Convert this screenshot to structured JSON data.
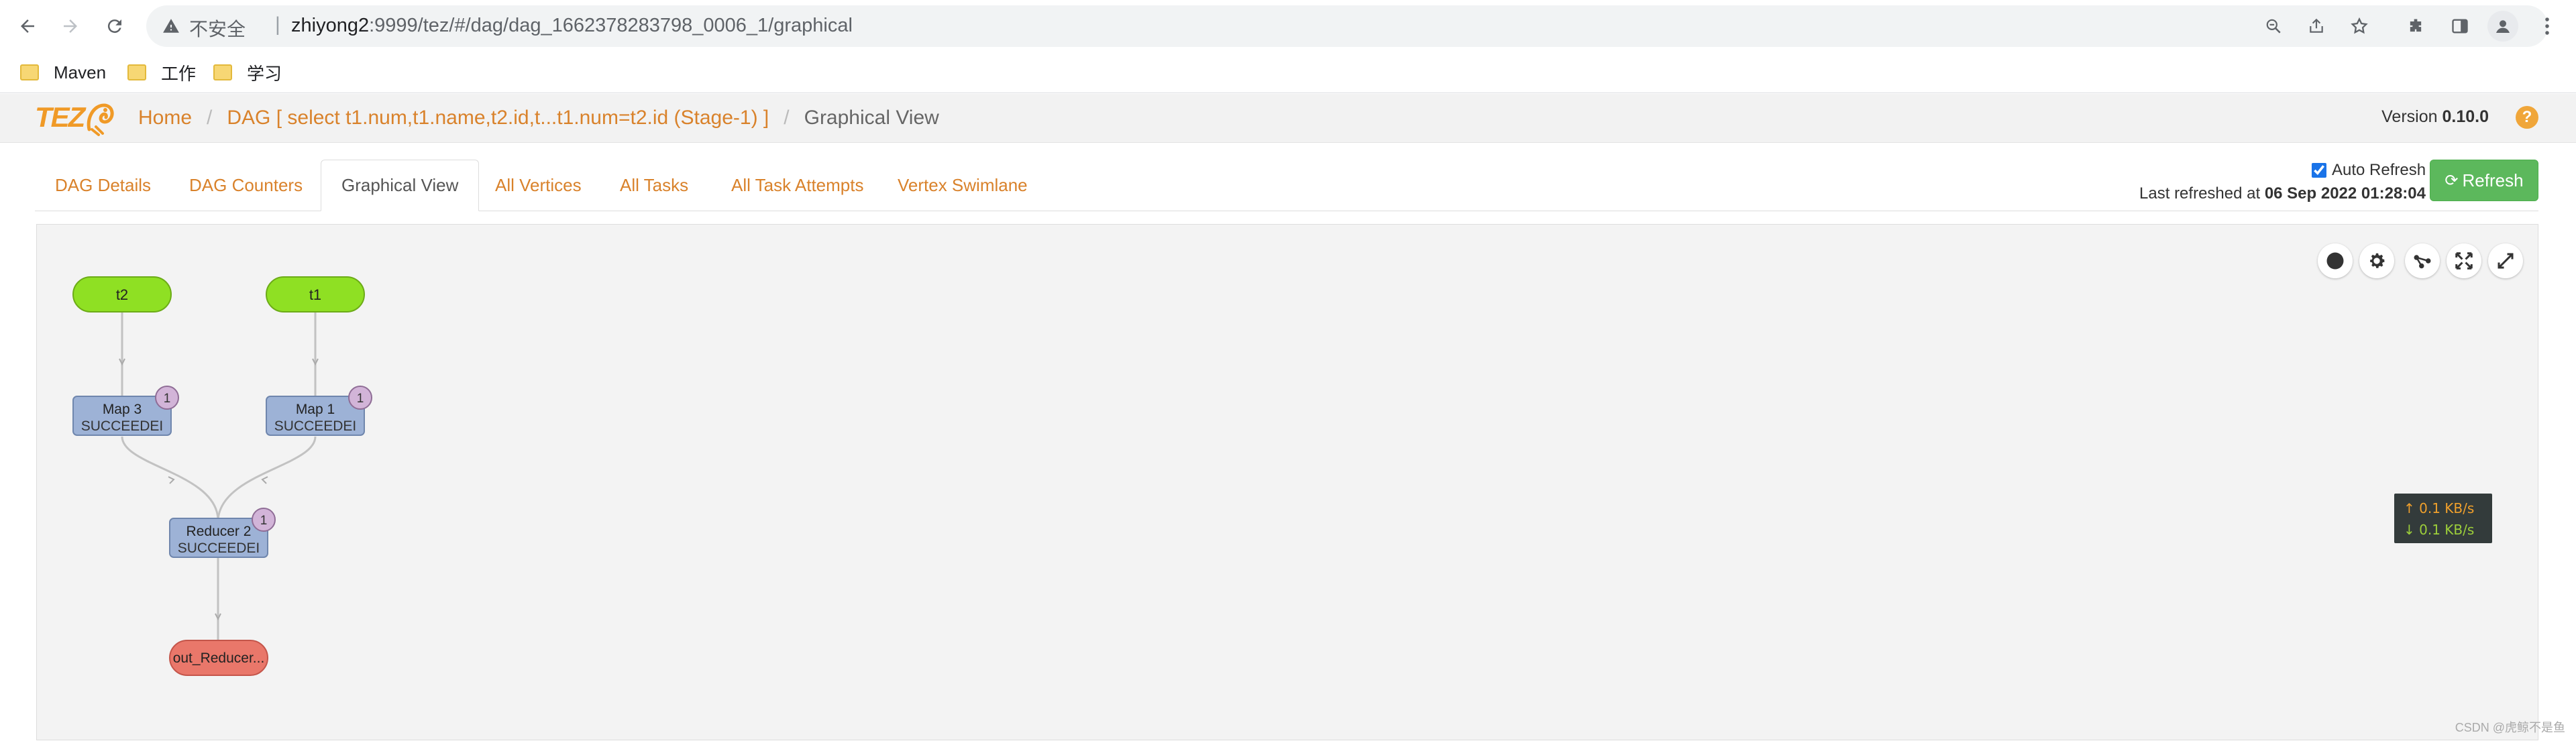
{
  "browser": {
    "security_label": "不安全",
    "url_host": "zhiyong2",
    "url_rest": ":9999/tez/#/dag/dag_1662378283798_0006_1/graphical",
    "bookmarks": [
      "Maven",
      "工作",
      "学习"
    ]
  },
  "header": {
    "logo_text": "TEZ",
    "breadcrumbs": {
      "home": "Home",
      "dag": "DAG [ select t1.num,t1.name,t2.id,t...t1.num=t2.id (Stage-1) ]",
      "current": "Graphical View"
    },
    "version_label": "Version",
    "version_value": "0.10.0",
    "help": "?"
  },
  "tabs": [
    {
      "label": "DAG Details"
    },
    {
      "label": "DAG Counters"
    },
    {
      "label": "Graphical View",
      "active": true
    },
    {
      "label": "All Vertices"
    },
    {
      "label": "All Tasks"
    },
    {
      "label": "All Task Attempts"
    },
    {
      "label": "Vertex Swimlane"
    }
  ],
  "refresh": {
    "auto_refresh_label": "Auto Refresh",
    "auto_refresh_checked": true,
    "last_refreshed_label": "Last refreshed at",
    "last_refreshed_value": "06 Sep 2022 01:28:04",
    "button_label": "Refresh"
  },
  "graph": {
    "sources": [
      {
        "name": "t2"
      },
      {
        "name": "t1"
      }
    ],
    "vertices": [
      {
        "name": "Map 3",
        "status": "SUCCEEDEI",
        "badge": "1"
      },
      {
        "name": "Map 1",
        "status": "SUCCEEDEI",
        "badge": "1"
      },
      {
        "name": "Reducer 2",
        "status": "SUCCEEDEI",
        "badge": "1"
      }
    ],
    "sink": {
      "name": "out_Reducer..."
    },
    "colors": {
      "source_fill": "#8fe023",
      "vertex_fill": "#9db2d6",
      "badge_fill": "#d2b4d8",
      "sink_fill": "#e9776a",
      "edge": "#c2c2c2"
    }
  },
  "tools": [
    "record-icon",
    "gear-icon",
    "share-graph-icon",
    "fit-screen-icon",
    "fullscreen-icon"
  ],
  "bandwidth": {
    "up": "↑ 0.1 KB/s",
    "down": "↓ 0.1 KB/s"
  },
  "watermark": "CSDN @虎鲸不是鱼"
}
